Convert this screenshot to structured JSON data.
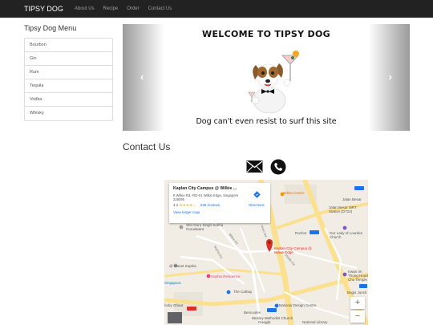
{
  "navbar": {
    "brand": "TIPSY DOG",
    "links": [
      "About Us",
      "Recipe",
      "Order",
      "Contact Us"
    ]
  },
  "sidebar": {
    "title": "Tipsy Dog Menu",
    "items": [
      "Bourbon",
      "Gin",
      "Rum",
      "Tequila",
      "Vodka",
      "Whisky"
    ]
  },
  "carousel": {
    "title": "WELCOME TO TIPSY DOG",
    "caption": "Dog can't even resist to surf this site",
    "prev": "‹",
    "next": "›"
  },
  "contact": {
    "title": "Contact Us"
  },
  "map": {
    "place_name": "Kaplan City Campus @ Wilkie ...",
    "address": "8 Wilkie Rd, #02-01 Wilkie Edge, Singapore 228095",
    "rating": "4.2",
    "stars": "★★★★☆",
    "reviews": "235 reviews",
    "directions": "Directions",
    "larger_map": "View larger map",
    "pin_label": "Kaplan City Campus @ Wilkie Edge",
    "labels": {
      "tekka": "Tekka Centre",
      "jalan_besar": "Jalan Besar",
      "jalan_besar_mrt": "Jalan Besar MRT Station (DT22)",
      "rochor": "Rochor",
      "shri_guru": "Shri Guru Singh Sabha Gurudwara",
      "our_lady": "Our Lady of Lourdes Church",
      "mount_sophia": "@ Mount Sophia",
      "sophia_residence": "Sophia Residence",
      "kwan_im": "Kwan Im Thong Hood Cho Temple",
      "singapura": "Singapura",
      "the_cathay": "The Cathay",
      "bugis": "Bugis Juncti",
      "hoby": "hoby Ghaut",
      "bencoolen": "Bencoolen",
      "national_design": "National Design Centre",
      "wesley": "Wesley Methodist Church",
      "national_library": "National Library",
      "google": "Google",
      "wilkie_rd": "Wilkie Rd",
      "sophia_rd": "Sophia Rd",
      "niven_rd": "Niven Rd",
      "middle_rd": "Middle Rd"
    },
    "zoom_in": "+",
    "zoom_out": "−"
  },
  "colors": {
    "navbar": "#222222",
    "pin": "#d93025",
    "link": "#1a73e8",
    "road_major": "#fbe08f"
  }
}
